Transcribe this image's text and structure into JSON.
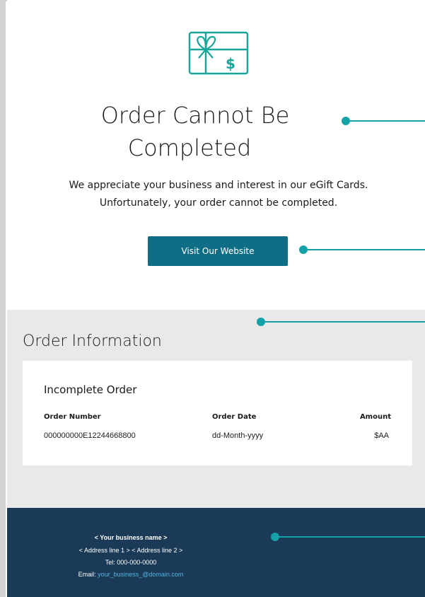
{
  "header": {
    "gift_icon": "gift-card-icon",
    "title_line1": "Order Cannot Be",
    "title_line2": "Completed",
    "desc_line1": "We appreciate your business and interest in our eGift Cards.",
    "desc_line2": "Unfortunately, your order cannot be completed.",
    "button_label": "Visit Our Website"
  },
  "order_info": {
    "section_title": "Order Information",
    "card_title": "Incomplete Order",
    "columns": [
      "Order Number",
      "Order Date",
      "Amount"
    ],
    "row": [
      "000000000E12244668800",
      "dd-Month-yyyy",
      "$AA"
    ]
  },
  "footer": {
    "business_name": "< Your business name >",
    "address": "< Address line 1 > < Address line 2 >",
    "tel": "Tel: 000-000-0000",
    "email_label": "Email:",
    "email": "your_business_@domain.com"
  },
  "colors": {
    "accent": "#0f6e86",
    "callout": "#14a1a8",
    "footer_bg": "#1b3a57",
    "info_bg": "#e9e9e9",
    "link": "#4fb6e0"
  }
}
